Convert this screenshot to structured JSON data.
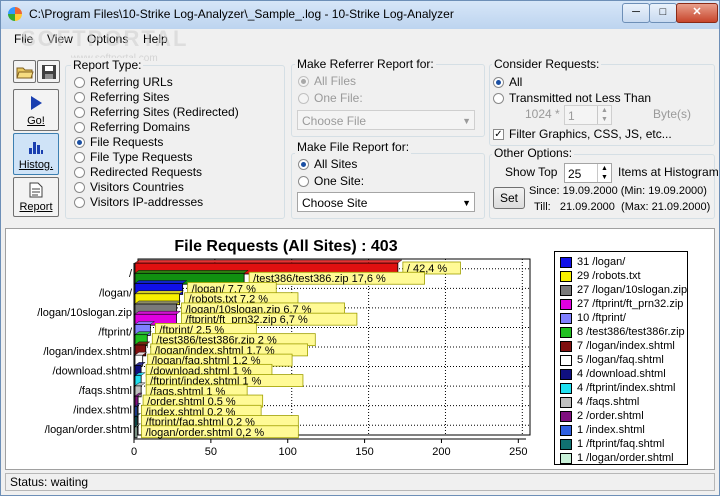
{
  "window": {
    "title": "C:\\Program Files\\10-Strike Log-Analyzer\\_Sample_.log - 10-Strike Log-Analyzer"
  },
  "menu": [
    {
      "label": "File"
    },
    {
      "label": "View"
    },
    {
      "label": "Options"
    },
    {
      "label": "Help"
    }
  ],
  "watermark": {
    "text": "SOFTPORTAL",
    "url": "www.softportal.com"
  },
  "toolbar": {
    "go_label": "Go!",
    "histog_label": "Histog.",
    "report_label": "Report"
  },
  "report_type": {
    "title": "Report Type:",
    "options": [
      "Referring URLs",
      "Referring Sites",
      "Referring Sites (Redirected)",
      "Referring Domains",
      "File Requests",
      "File Type Requests",
      "Redirected Requests",
      "Visitors Countries",
      "Visitors IP-addresses"
    ],
    "selected": "File Requests"
  },
  "referrer_report": {
    "title": "Make Referrer Report for:",
    "all_files": "All Files",
    "one_file": "One File:",
    "combo_value": "Choose File"
  },
  "file_report": {
    "title": "Make File Report for:",
    "all_sites": "All Sites",
    "one_site": "One Site:",
    "combo_value": "Choose Site"
  },
  "consider": {
    "title": "Consider Requests:",
    "all": "All",
    "transmitted": "Transmitted not Less Than",
    "size_label": "1024 *",
    "size_value": "1",
    "size_unit": "Byte(s)",
    "filter_label": "Filter Graphics, CSS, JS, etc...",
    "filter_checked": true
  },
  "other": {
    "title": "Other Options:",
    "show_top_label": "Show Top",
    "show_top_value": "25",
    "items_label": "Items at Histogram",
    "set_label": "Set",
    "since": "Since: 19.09.2000  (Min: 19.09.2000)",
    "till": "Till:   21.09.2000  (Max: 21.09.2000)"
  },
  "status": {
    "text": "Status: waiting"
  },
  "chart_data": {
    "type": "bar",
    "orientation": "horizontal",
    "title": "File Requests (All Sites) : 403",
    "x_ticks": [
      0,
      50,
      100,
      150,
      200,
      250
    ],
    "xlim": [
      0,
      255
    ],
    "y_tick_labels": [
      "/",
      "/logan/",
      "/logan/10slogan.zip",
      "/ftprint/",
      "/logan/index.shtml",
      "/download.shtml",
      "/faqs.shtml",
      "/index.shtml",
      "/logan/order.shtml"
    ],
    "series": [
      {
        "label": "/logan/",
        "value": 31,
        "color": "#1010e8",
        "data_label": "/logan/ 7,7 %"
      },
      {
        "label": "/robots.txt",
        "value": 29,
        "color": "#f8f000",
        "data_label": "/robots.txt 7,2 %"
      },
      {
        "label": "/logan/10slogan.zip",
        "value": 27,
        "color": "#7a7a7a",
        "data_label": "/logan/10slogan.zip 6,7 %"
      },
      {
        "label": "/ftprint/ft_prn32.zip",
        "value": 27,
        "color": "#e000e0",
        "data_label": "/ftprint/ft_prn32.zip 6,7 %"
      },
      {
        "label": "/ftprint/",
        "value": 10,
        "color": "#8080ff",
        "data_label": "/ftprint/ 2,5 %"
      },
      {
        "label": "/test386/test386r.zip",
        "value": 8,
        "color": "#20c020",
        "data_label": "/test386/test386r.zip 2 %"
      },
      {
        "label": "/logan/index.shtml",
        "value": 7,
        "color": "#801010",
        "data_label": "/logan/index.shtml 1,7 %"
      },
      {
        "label": "/logan/faq.shtml",
        "value": 5,
        "color": "#ffffff",
        "data_label": "/logan/faq.shtml 1,2 %"
      },
      {
        "label": "/download.shtml",
        "value": 4,
        "color": "#101080",
        "data_label": "/download.shtml 1 %"
      },
      {
        "label": "/ftprint/index.shtml",
        "value": 4,
        "color": "#20e0f0",
        "data_label": "/ftprint/index.shtml 1 %"
      },
      {
        "label": "/faqs.shtml",
        "value": 4,
        "color": "#c0c0c0",
        "data_label": "/faqs.shtml 1 %"
      },
      {
        "label": "/order.shtml",
        "value": 2,
        "color": "#801080",
        "data_label": "/order.shtml 0,5 %"
      },
      {
        "label": "/index.shtml",
        "value": 1,
        "color": "#3060e0",
        "data_label": "/index.shtml 0,2 %"
      },
      {
        "label": "/ftprint/faq.shtml",
        "value": 1,
        "color": "#107070",
        "data_label": "/ftprint/faq.shtml 0,2 %"
      },
      {
        "label": "/logan/order.shtml",
        "value": 1,
        "color": "#c8f0d8",
        "data_label": "/logan/order.shtml 0,2 %"
      }
    ],
    "top_bars": [
      {
        "label": "/",
        "value": 171,
        "color": "#e01010",
        "data_label": "/ 42,4 %"
      },
      {
        "label": "/test386/test386.zip",
        "value": 71,
        "color": "#109010",
        "data_label": "/test386/test386.zip 17,6 %"
      }
    ],
    "legend": [
      "31 /logan/",
      "29 /robots.txt",
      "27 /logan/10slogan.zip",
      "27 /ftprint/ft_prn32.zip",
      "10 /ftprint/",
      "8 /test386/test386r.zip",
      "7 /logan/index.shtml",
      "5 /logan/faq.shtml",
      "4 /download.shtml",
      "4 /ftprint/index.shtml",
      "4 /faqs.shtml",
      "2 /order.shtml",
      "1 /index.shtml",
      "1 /ftprint/faq.shtml",
      "1 /logan/order.shtml"
    ],
    "legend_colors": [
      "#1010e8",
      "#f8f000",
      "#7a7a7a",
      "#e000e0",
      "#8080ff",
      "#20c020",
      "#801010",
      "#ffffff",
      "#101080",
      "#20e0f0",
      "#c0c0c0",
      "#801080",
      "#3060e0",
      "#107070",
      "#c8f0d8"
    ],
    "grid": true,
    "legend_position": "right"
  }
}
